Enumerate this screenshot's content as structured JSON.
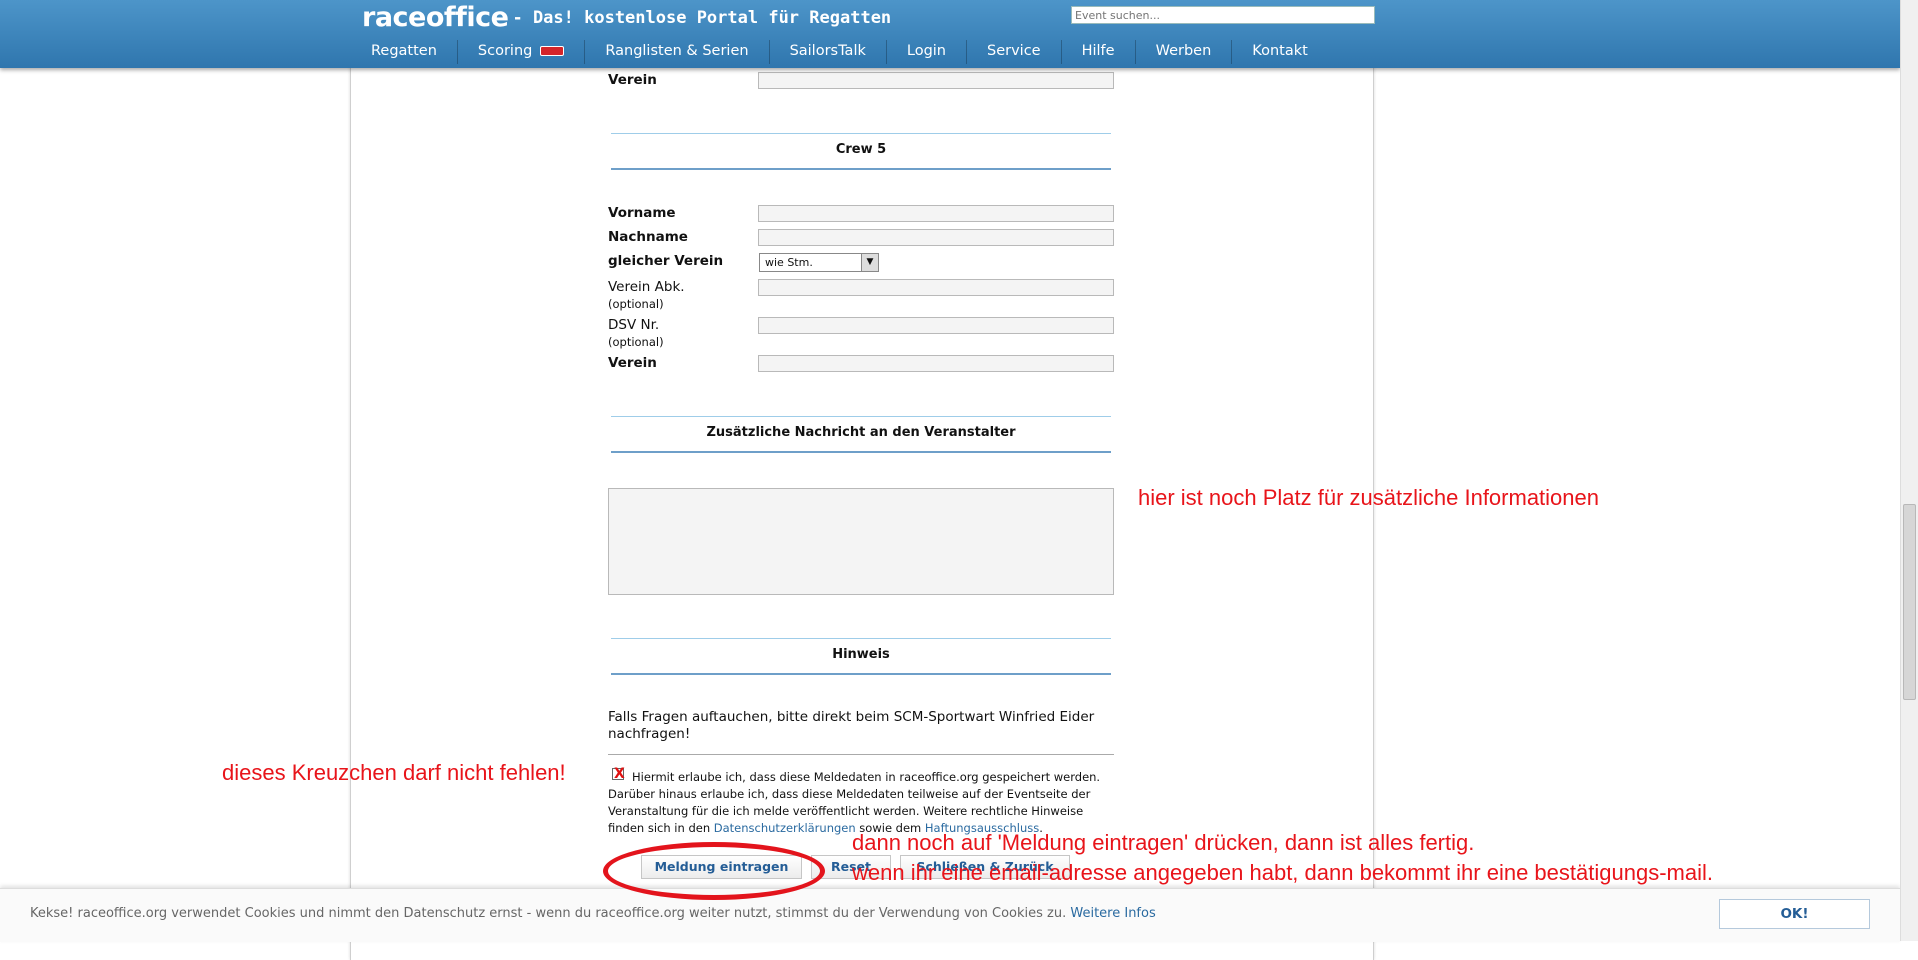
{
  "header": {
    "brand": "raceoffice",
    "slogan": "- Das! kostenlose Portal für Regatten",
    "search_placeholder": "Event suchen...",
    "nav": [
      {
        "label": "Regatten"
      },
      {
        "label": "Scoring"
      },
      {
        "label": "Ranglisten & Serien"
      },
      {
        "label": "SailorsTalk"
      },
      {
        "label": "Login"
      },
      {
        "label": "Service"
      },
      {
        "label": "Hilfe"
      },
      {
        "label": "Werben"
      },
      {
        "label": "Kontakt"
      }
    ]
  },
  "form": {
    "top_verein_label": "Verein",
    "crew5": {
      "title": "Crew 5",
      "vorname": "Vorname",
      "nachname": "Nachname",
      "gleicher_verein": "gleicher Verein",
      "gleicher_verein_value": "wie Stm.",
      "verein_abk": "Verein Abk.",
      "dsv_nr": "DSV Nr.",
      "optional": "(optional)",
      "verein": "Verein"
    },
    "message_title": "Zusätzliche Nachricht an den Veranstalter",
    "hint_title": "Hinweis",
    "hint_text": "Falls Fragen auftauchen, bitte direkt beim SCM-Sportwart Winfried Eider nachfragen!",
    "consent_text_1": "Hiermit erlaube ich, dass diese Meldedaten in raceoffice.org gespeichert werden. Darüber hinaus erlaube ich, dass diese Meldedaten teilweise auf der Eventseite der Veranstaltung für die ich melde veröffentlicht werden. Weitere rechtliche Hinweise finden sich in den ",
    "consent_link_1": "Datenschutzerklärungen",
    "consent_text_2": " sowie dem ",
    "consent_link_2": "Haftungsausschluss",
    "consent_text_3": ".",
    "checkbox_mark": "X",
    "buttons": {
      "submit": "Meldung eintragen",
      "reset": "Reset",
      "close": "Schließen & Zurück"
    }
  },
  "cookie": {
    "text": "Kekse! raceoffice.org verwendet Cookies und nimmt den Datenschutz ernst - wenn du raceoffice.org weiter nutzt, stimmst du der Verwendung von Cookies zu. ",
    "link": "Weitere Infos",
    "ok": "OK!"
  },
  "annotations": {
    "info_space": "hier ist noch Platz für zusätzliche Informationen",
    "checkbox_note": "dieses Kreuzchen darf nicht fehlen!",
    "submit_note_1": "dann noch auf 'Meldung eintragen' drücken, dann ist alles fertig.",
    "submit_note_2": "wenn ihr eine email-adresse angegeben habt, dann bekommt ihr eine bestätigungs-mail."
  },
  "colors": {
    "header_blue": "#3d86bd",
    "annotation_red": "#e8141a",
    "link_blue": "#2a6aa0"
  }
}
